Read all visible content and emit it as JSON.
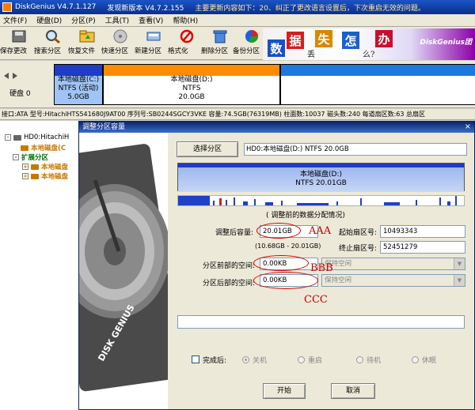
{
  "titlebar": {
    "app": "DiskGenius V4.7.1.127",
    "new_version": "发现新版本 V4.7.2.155",
    "notice": "主要更新内容如下：20、纠正了更改语言设置后，下次重启无效的问题。"
  },
  "menu": [
    "文件(F)",
    "硬盘(D)",
    "分区(P)",
    "工具(T)",
    "查看(V)",
    "帮助(H)"
  ],
  "toolbar": [
    {
      "label": "保存更改",
      "icon": "save-icon"
    },
    {
      "label": "搜索分区",
      "icon": "search-icon"
    },
    {
      "label": "恢复文件",
      "icon": "folder-icon"
    },
    {
      "label": "快速分区",
      "icon": "disk-icon"
    },
    {
      "label": "新建分区",
      "icon": "new-partition-icon"
    },
    {
      "label": "格式化",
      "icon": "format-icon"
    },
    {
      "label": "删除分区",
      "icon": "trash-icon"
    },
    {
      "label": "备份分区",
      "icon": "backup-icon"
    }
  ],
  "banner": {
    "chars": [
      "数",
      "据",
      "失",
      "怎",
      "办"
    ],
    "small": [
      "丢",
      "么?"
    ],
    "logo": "DiskGenius团"
  },
  "disk": {
    "label": "硬盘 0",
    "partitions": [
      {
        "name": "本地磁盘(C:)",
        "fs": "NTFS (活动)",
        "size": "5.0GB"
      },
      {
        "name": "本地磁盘(D:)",
        "fs": "NTFS",
        "size": "20.0GB"
      }
    ]
  },
  "infoline": "接口:ATA  型号:HitachiHTS541680J9AT00  序列号:SB0244SGCY3VKE  容量:74.5GB(76319MB)  柱面数:10037  磁头数:240  每道扇区数:63  总扇区",
  "tree": {
    "root": "HD0:HitachiH",
    "item1": "本地磁盘(C",
    "ext": "扩展分区",
    "item2": "本地磁盘",
    "item3": "本地磁盘"
  },
  "dialog": {
    "title": "调整分区容量",
    "close": "×",
    "select_button": "选择分区",
    "selected_partition": "HD0:本地磁盘(D:) NTFS 20.0GB",
    "bar_name": "本地磁盘(D:)",
    "bar_info": "NTFS 20.01GB",
    "caption": "( 调整前的数据分配情况)",
    "size_label": "调整后容量:",
    "size_value": "20.01GB",
    "size_range": "(10.68GB - 20.01GB)",
    "start_label": "起始扇区号:",
    "start_value": "10493343",
    "end_label": "终止扇区号:",
    "end_value": "52451279",
    "front_label": "分区前部的空间:",
    "front_value": "0.00KB",
    "front_option": "保持空闲",
    "back_label": "分区后部的空间:",
    "back_value": "0.00KB",
    "back_option": "保持空闲",
    "after_label": "完成后:",
    "radios": [
      "关机",
      "重启",
      "待机",
      "休眠"
    ],
    "start_button": "开始",
    "cancel_button": "取消"
  },
  "annotations": {
    "a": "AAA",
    "b": "BBB",
    "c": "CCC"
  },
  "colors": {
    "annotation": "#c00000",
    "partition_c_band": "#1e3cc8",
    "partition_d_band": "#ff8c00",
    "free_space": "#1e78e0"
  }
}
